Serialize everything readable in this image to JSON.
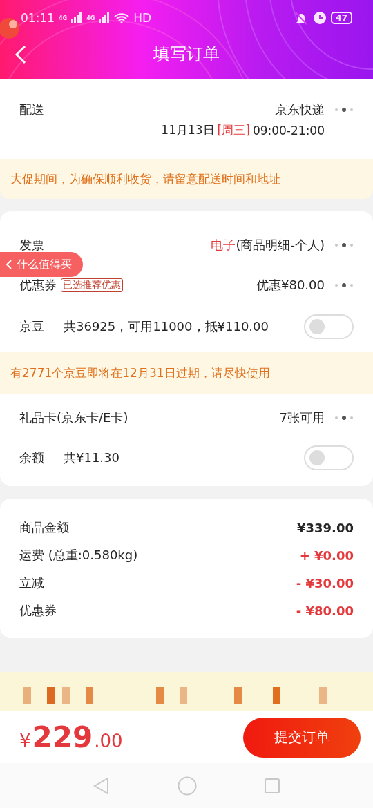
{
  "status_bar": {
    "time": "01:11",
    "network_1": "4G",
    "network_2": "4G",
    "hd": "HD",
    "battery": "47"
  },
  "header": {
    "title": "填写订单"
  },
  "delivery": {
    "label": "配送",
    "carrier": "京东快递",
    "date": "11月13日",
    "weekday": "[周三]",
    "time_range": "09:00-21:00"
  },
  "notice_1": "大促期间，为确保顺利收货，请留意配送时间和地址",
  "invoice": {
    "label": "发票",
    "type": "电子",
    "detail": "(商品明细-个人)"
  },
  "coupon": {
    "label": "优惠券",
    "tag": "已选推荐优惠",
    "value": "优惠¥80.00"
  },
  "beans": {
    "label": "京豆",
    "detail": "共36925，可用11000，抵¥110.00",
    "on": false
  },
  "notice_2": "有2771个京豆即将在12月31日过期，请尽快使用",
  "gift_card": {
    "label": "礼品卡(京东卡/E卡)",
    "value": "7张可用"
  },
  "balance": {
    "label": "余额",
    "detail": "共¥11.30",
    "on": false
  },
  "summary": [
    {
      "label": "商品金额",
      "value": "¥339.00",
      "kind": "plain"
    },
    {
      "label": "运费 (总重:0.580kg)",
      "value": "+ ¥0.00",
      "kind": "adjust"
    },
    {
      "label": "立减",
      "value": "- ¥30.00",
      "kind": "adjust"
    },
    {
      "label": "优惠券",
      "value": "- ¥80.00",
      "kind": "adjust"
    }
  ],
  "total": {
    "currency": "¥",
    "integer": "229",
    "decimal": ".00"
  },
  "submit_button": "提交订单",
  "floating_badge": {
    "label": "什么值得买"
  }
}
